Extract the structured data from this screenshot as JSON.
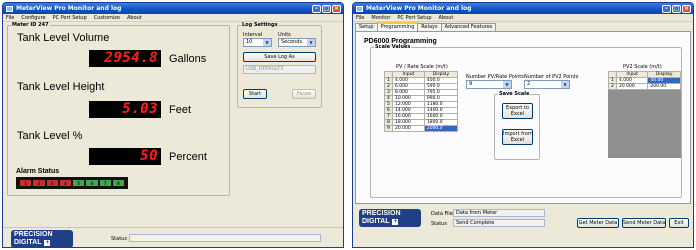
{
  "left_window": {
    "title": "MeterView Pro Monitor and log",
    "menu": [
      "File",
      "Configure",
      "PC Port Setup",
      "Customize",
      "About"
    ],
    "meter_group": "Meter ID 247",
    "displays": [
      {
        "label": "Tank Level Volume",
        "value": "2954.8",
        "unit": "Gallons"
      },
      {
        "label": "Tank Level Height",
        "value": "5.03",
        "unit": "Feet"
      },
      {
        "label": "Tank Level %",
        "value": "50",
        "unit": "Percent"
      }
    ],
    "alarm_label": "Alarm Status",
    "alarm_leds": [
      {
        "n": "1",
        "color": "#cc2d2d"
      },
      {
        "n": "2",
        "color": "#cc2d2d"
      },
      {
        "n": "3",
        "color": "#cc2d2d"
      },
      {
        "n": "4",
        "color": "#cc2d2d"
      },
      {
        "n": "5",
        "color": "#3ea84b"
      },
      {
        "n": "6",
        "color": "#3ea84b"
      },
      {
        "n": "7",
        "color": "#3ea84b"
      },
      {
        "n": "8",
        "color": "#3ea84b"
      }
    ],
    "log_settings": {
      "title": "Log Settings",
      "interval_label": "Interval",
      "interval_value": "10",
      "units_label": "Units",
      "units_value": "Seconds",
      "save_button": "Save Log As",
      "path": "USB_DEFAULT3",
      "start_button": "Start",
      "pause_button": "Pause"
    },
    "logo": {
      "line1": "PRECISION",
      "line2": "DIGITAL"
    },
    "status_label": "Status",
    "status_value": ""
  },
  "right_window": {
    "title": "MeterView Pro Monitor and log",
    "menu": [
      "File",
      "Monitor",
      "PC Port Setup",
      "About"
    ],
    "tabs": [
      "Setup",
      "Programming",
      "Relays",
      "Advanced Features"
    ],
    "active_tab": "Programming",
    "panel_title": "PD6000 Programming",
    "scale_values_label": "Scale Values",
    "pv_table": {
      "title": "PV / Rate Scale (m/t)",
      "headers": [
        "Input",
        "Display"
      ],
      "rows": [
        [
          "1",
          "4.000",
          "400.0"
        ],
        [
          "2",
          "6.000",
          "590.0"
        ],
        [
          "3",
          "8.000",
          "795.0"
        ],
        [
          "4",
          "10.000",
          "990.0"
        ],
        [
          "5",
          "12.000",
          "1180.0"
        ],
        [
          "6",
          "14.000",
          "1400.0"
        ],
        [
          "7",
          "16.000",
          "1600.0"
        ],
        [
          "8",
          "18.000",
          "1800.0"
        ],
        [
          "9",
          "20.000",
          "2000.0"
        ]
      ]
    },
    "pv_points": {
      "label": "Number PV/Rate Points",
      "value": "9"
    },
    "pv2_points": {
      "label": "Number of PV2 Points",
      "value": "2"
    },
    "save_scale": {
      "title": "Save Scale",
      "export_button": [
        "Export to",
        "Excel"
      ],
      "import_button": [
        "Import from",
        "Excel"
      ]
    },
    "pv2_table": {
      "title": "PV2 Scale (m/t)",
      "headers": [
        "Input",
        "Display"
      ],
      "rows": [
        [
          "1",
          "4.000",
          "40.00"
        ],
        [
          "2",
          "20.000",
          "200.00"
        ]
      ]
    },
    "data_file_label": "Data File",
    "data_file_value": "Data from Meter",
    "status_label": "Status",
    "status_value": "Send Complete",
    "get_button": "Get Meter Data",
    "send_button": "Send Meter Data",
    "exit_button": "Exit"
  }
}
